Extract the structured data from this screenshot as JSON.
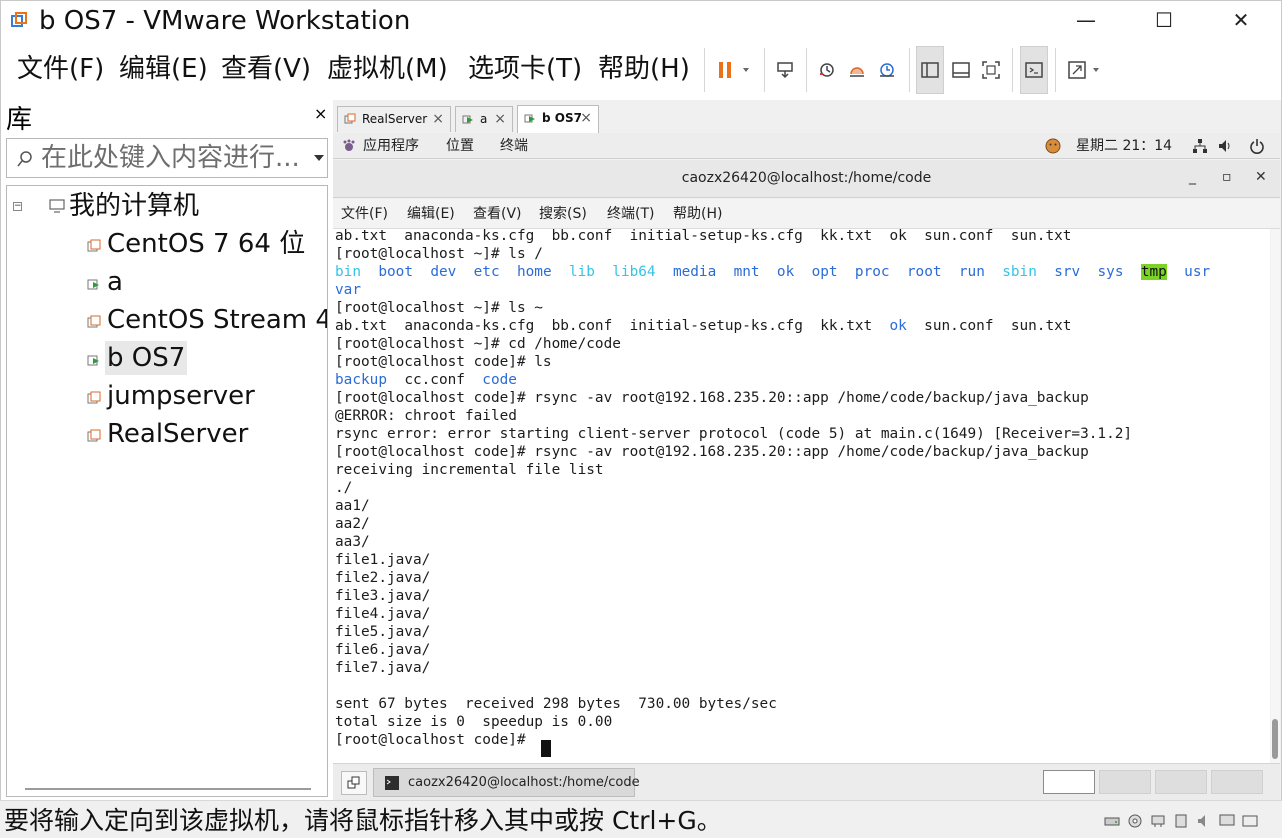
{
  "window": {
    "title": "b OS7 - VMware Workstation",
    "minimize": "—",
    "maximize": "☐",
    "close": "✕"
  },
  "menu": [
    "文件(F)",
    "编辑(E)",
    "查看(V)",
    "虚拟机(M)",
    "选项卡(T)",
    "帮助(H)"
  ],
  "library": {
    "title": "库",
    "close": "×",
    "search_placeholder": "在此处键入内容进行...",
    "root": "我的计算机",
    "vms": [
      "CentOS 7 64 位",
      "a",
      "CentOS Stream 4",
      "b OS7",
      "jumpserver",
      "RealServer"
    ]
  },
  "vm_tabs": [
    {
      "label": "RealServer",
      "close": "×"
    },
    {
      "label": "a",
      "close": "×"
    },
    {
      "label": "b OS7",
      "close": "×"
    }
  ],
  "gnome": {
    "applications": "应用程序",
    "places": "位置",
    "terminal": "终端",
    "clock": "星期二 21：14"
  },
  "terminal": {
    "title": "caozx26420@localhost:/home/code",
    "minimize": "_",
    "maximize": "▫",
    "close": "✕",
    "menu": [
      "文件(F)",
      "编辑(E)",
      "查看(V)",
      "搜索(S)",
      "终端(T)",
      "帮助(H)"
    ],
    "lines": [
      "ab.txt  anaconda-ks.cfg  bb.conf  initial-setup-ks.cfg  kk.txt  ok  sun.conf  sun.txt",
      "[root@localhost ~]# ls /",
      "bin  boot  dev  etc  home  lib  lib64  media  mnt  ok  opt  proc  root  run  sbin  srv  sys  tmp  usr",
      "var",
      "[root@localhost ~]# ls ~",
      "ab.txt  anaconda-ks.cfg  bb.conf  initial-setup-ks.cfg  kk.txt  ok  sun.conf  sun.txt",
      "[root@localhost ~]# cd /home/code",
      "[root@localhost code]# ls",
      "backup  cc.conf  code",
      "[root@localhost code]# rsync -av root@192.168.235.20::app /home/code/backup/java_backup",
      "@ERROR: chroot failed",
      "rsync error: error starting client-server protocol (code 5) at main.c(1649) [Receiver=3.1.2]",
      "[root@localhost code]# rsync -av root@192.168.235.20::app /home/code/backup/java_backup",
      "receiving incremental file list",
      "./",
      "aa1/",
      "aa2/",
      "aa3/",
      "file1.java/",
      "file2.java/",
      "file3.java/",
      "file4.java/",
      "file5.java/",
      "file6.java/",
      "file7.java/",
      "",
      "sent 67 bytes  received 298 bytes  730.00 bytes/sec",
      "total size is 0  speedup is 0.00",
      "[root@localhost code]# "
    ]
  },
  "taskbar": {
    "terminal_task": "caozx26420@localhost:/home/code"
  },
  "status": {
    "message": "要将输入定向到该虚拟机，请将鼠标指针移入其中或按 Ctrl+G。"
  },
  "colors": {
    "dir_blue": "#2b6cd6",
    "link_cyan": "#35c3e6",
    "tmp_highlight": "#7bd424",
    "pause_orange": "#e8731a"
  }
}
